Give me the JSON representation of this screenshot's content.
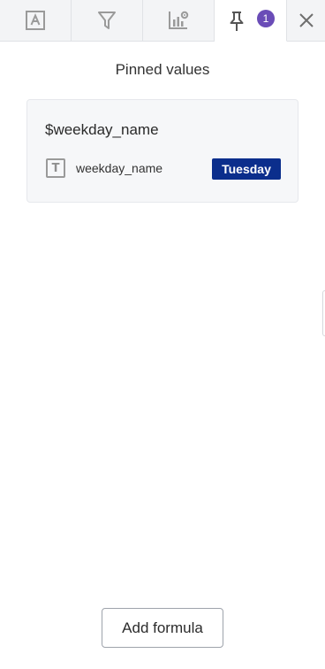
{
  "tabs": [
    {
      "icon": "text-format-icon"
    },
    {
      "icon": "filter-icon"
    },
    {
      "icon": "chart-settings-icon"
    },
    {
      "icon": "pin-icon",
      "badge": "1",
      "active": true
    }
  ],
  "close": {
    "icon": "close-icon"
  },
  "panel": {
    "title": "Pinned values",
    "card": {
      "title": "$weekday_name",
      "type_icon_letter": "T",
      "variable_name": "weekday_name",
      "value": "Tuesday"
    }
  },
  "footer": {
    "add_formula_label": "Add formula"
  },
  "colors": {
    "badge": "#6a4cb7",
    "value_pill": "#0b2e8c"
  }
}
